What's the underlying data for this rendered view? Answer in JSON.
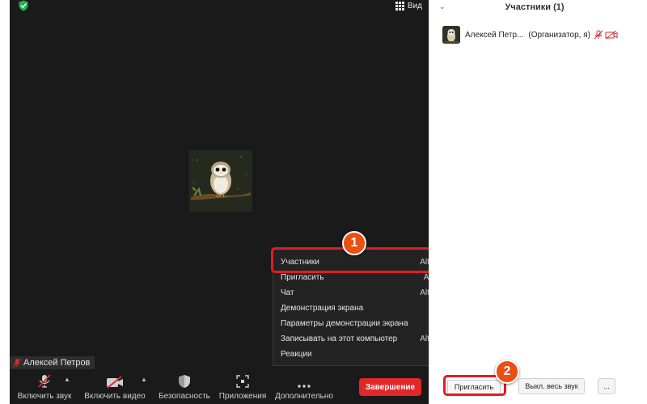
{
  "colors": {
    "accent_highlight": "#e51b23",
    "badge": "#ea4f14",
    "end_button": "#e02828",
    "security_green": "#22b14c",
    "meeting_bg": "#1a1a1a"
  },
  "header": {
    "view_label": "Вид"
  },
  "video": {
    "participant_name": "Алексей Петров"
  },
  "toolbar": {
    "unmute_label": "Включить звук",
    "start_video_label": "Включить видео",
    "security_label": "Безопасность",
    "apps_label": "Приложения",
    "more_label": "Дополнительно",
    "end_label": "Завершение"
  },
  "menu": {
    "items": [
      {
        "label": "Участники",
        "shortcut": "Alt+U"
      },
      {
        "label": "Пригласить",
        "shortcut": "Alt+I"
      },
      {
        "label": "Чат",
        "shortcut": "Alt+H"
      },
      {
        "label": "Демонстрация экрана",
        "shortcut": ""
      },
      {
        "label": "Параметры демонстрации экрана",
        "shortcut": ""
      },
      {
        "label": "Записывать на этот компьютер",
        "shortcut": "Alt+R"
      },
      {
        "label": "Реакции",
        "shortcut": ""
      }
    ]
  },
  "badges": {
    "first": "1",
    "second": "2"
  },
  "panel": {
    "title": "Участники (1)",
    "participant": {
      "name": "Алексей Петр...",
      "role": "(Организатор, я)"
    },
    "invite_label": "Пригласить",
    "mute_all_label": "Выкл. весь звук",
    "more_label": "..."
  }
}
